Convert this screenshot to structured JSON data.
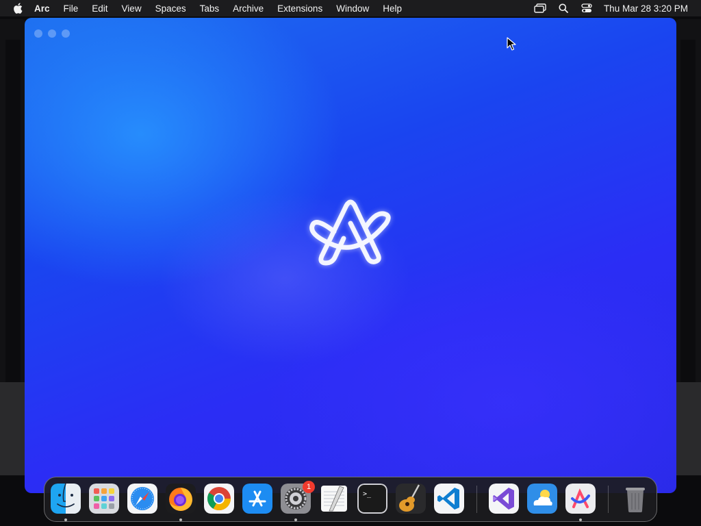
{
  "menubar": {
    "app_name": "Arc",
    "items": [
      "File",
      "Edit",
      "View",
      "Spaces",
      "Tabs",
      "Archive",
      "Extensions",
      "Window",
      "Help"
    ],
    "status_icons": [
      "screen-mirroring-icon",
      "search-icon",
      "control-center-icon"
    ],
    "clock": "Thu Mar 28  3:20 PM"
  },
  "window": {
    "app": "Arc",
    "state": "launch splash",
    "accent_colors": {
      "top_left": "#1e6ff0",
      "bottom_right": "#2a2ae8"
    }
  },
  "dock": {
    "apps": [
      {
        "name": "Finder",
        "icon": "finder-icon",
        "running": true
      },
      {
        "name": "Launchpad",
        "icon": "launchpad-icon",
        "running": false
      },
      {
        "name": "Safari",
        "icon": "safari-icon",
        "running": false
      },
      {
        "name": "Firefox",
        "icon": "firefox-icon",
        "running": true
      },
      {
        "name": "Google Chrome",
        "icon": "chrome-icon",
        "running": false
      },
      {
        "name": "App Store",
        "icon": "app-store-icon",
        "running": false
      },
      {
        "name": "System Settings",
        "icon": "settings-icon",
        "running": true,
        "badge": "1"
      },
      {
        "name": "TextEdit",
        "icon": "textedit-icon",
        "running": false
      },
      {
        "name": "Terminal",
        "icon": "terminal-icon",
        "running": false
      },
      {
        "name": "GarageBand",
        "icon": "garageband-icon",
        "running": false
      },
      {
        "name": "Visual Studio Code",
        "icon": "vscode-icon",
        "running": false
      },
      {
        "name": "Visual Studio",
        "icon": "visual-studio-icon",
        "running": false
      },
      {
        "name": "Weather",
        "icon": "weather-icon",
        "running": false
      },
      {
        "name": "Arc",
        "icon": "arc-icon",
        "running": true
      },
      {
        "name": "Trash",
        "icon": "trash-icon",
        "running": false
      }
    ]
  }
}
